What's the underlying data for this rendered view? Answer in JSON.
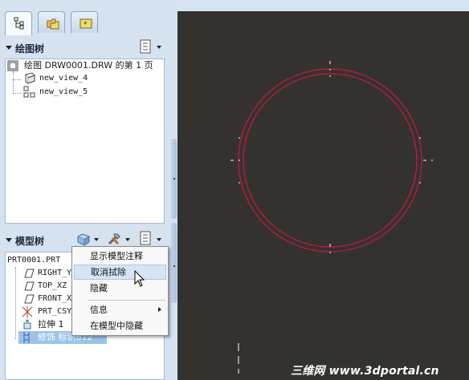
{
  "navigator_tabs": [
    {
      "icon": "model-tree-icon",
      "active": true
    },
    {
      "icon": "folder-browser-icon",
      "active": false
    },
    {
      "icon": "favorites-icon",
      "active": false
    }
  ],
  "drawing_tree": {
    "title": "绘图树",
    "root_label": "绘图 DRW0001.DRW 的第 1 页",
    "items": [
      "new_view_4",
      "new_view_5"
    ]
  },
  "model_tree": {
    "title": "模型树",
    "root_label": "PRT0001.PRT",
    "items": [
      {
        "label": "RIGHT_Y",
        "icon": "datum-plane-icon"
      },
      {
        "label": "TOP_XZ",
        "icon": "datum-plane-icon"
      },
      {
        "label": "FRONT_X",
        "icon": "datum-plane-icon"
      },
      {
        "label": "PRT_CSY",
        "icon": "coordinate-system-icon"
      },
      {
        "label": "拉伸 1",
        "icon": "extrude-icon"
      },
      {
        "label": "修饰 标识612",
        "icon": "cosmetic-feature-icon"
      }
    ]
  },
  "context_menu": {
    "items": [
      {
        "label": "显示模型注释",
        "hover": false,
        "submenu": false
      },
      {
        "label": "取消拭除",
        "hover": true,
        "submenu": false
      },
      {
        "label": "隐藏",
        "hover": false,
        "submenu": false
      },
      {
        "label": "信息",
        "hover": false,
        "submenu": true
      },
      {
        "label": "在模型中隐藏",
        "hover": false,
        "submenu": false
      }
    ]
  },
  "watermark": "三维网 www.3dportal.cn",
  "colors": {
    "canvas_background": "#34322f",
    "circle_stroke": "#c8193f",
    "panel_background": "#d5e2f0",
    "menu_hover": "#d6e5f5"
  }
}
